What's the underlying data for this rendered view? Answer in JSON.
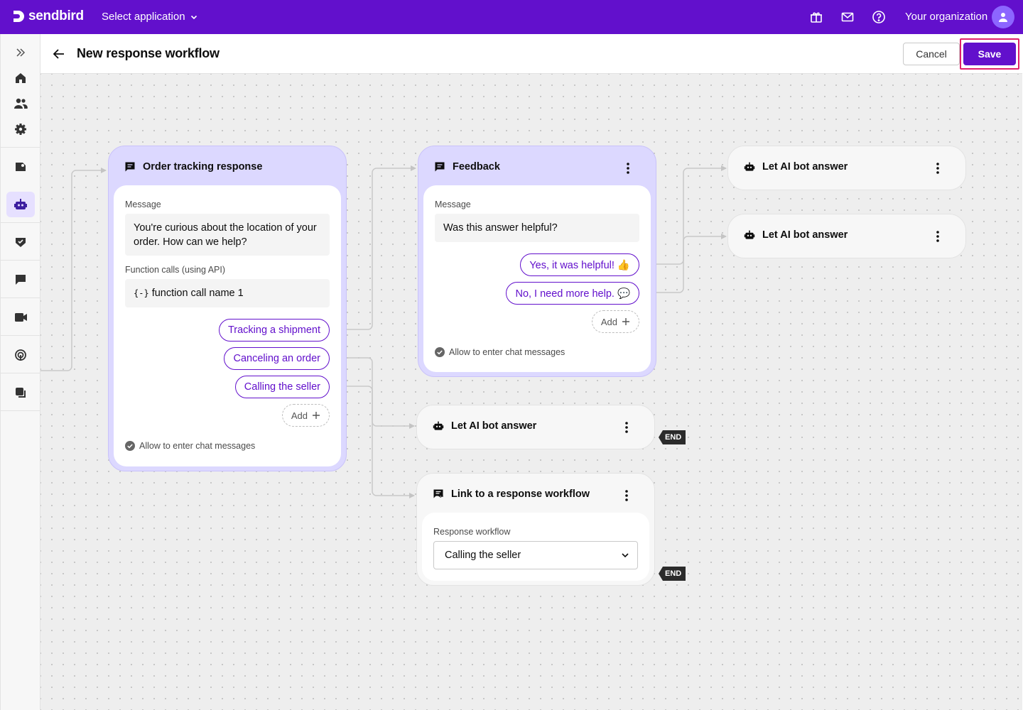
{
  "brand": {
    "name": "sendbird",
    "accent": "#6210cc",
    "highlight": "#e01f6a"
  },
  "topbar": {
    "app_select": "Select application",
    "icons": [
      "gift-icon",
      "mail-icon",
      "help-icon"
    ],
    "organization": "Your organization"
  },
  "sidebar": {
    "items": [
      "expand-icon",
      "home-icon",
      "users-icon",
      "settings-icon",
      "desk-icon",
      "bot-icon",
      "moderation-icon",
      "chat-icon",
      "calls-icon",
      "notifications-icon",
      "messages-icon"
    ],
    "active": "bot-icon"
  },
  "header": {
    "title": "New response workflow",
    "cancel": "Cancel",
    "save": "Save"
  },
  "nodes": {
    "order_tracking": {
      "title": "Order tracking response",
      "message_label": "Message",
      "message": "You're curious about the location of your order. How can we help?",
      "function_label": "Function calls (using API)",
      "function_icon": "{-}",
      "function_name": "function call name 1",
      "options": [
        "Tracking a shipment",
        "Canceling an order",
        "Calling the seller"
      ],
      "add": "Add",
      "allow": "Allow to enter chat messages"
    },
    "feedback": {
      "title": "Feedback",
      "message_label": "Message",
      "message": "Was this answer helpful?",
      "options": [
        "Yes, it was helpful! 👍",
        "No, I need more help. 💬"
      ],
      "add": "Add",
      "allow": "Allow to enter chat messages"
    },
    "ai_answer_1": {
      "title": "Let AI bot answer"
    },
    "ai_answer_2": {
      "title": "Let AI bot answer"
    },
    "ai_answer_3": {
      "title": "Let AI bot answer",
      "end": "END"
    },
    "link_workflow": {
      "title": "Link to a response workflow",
      "field_label": "Response workflow",
      "selected": "Calling the seller",
      "end": "END"
    }
  }
}
